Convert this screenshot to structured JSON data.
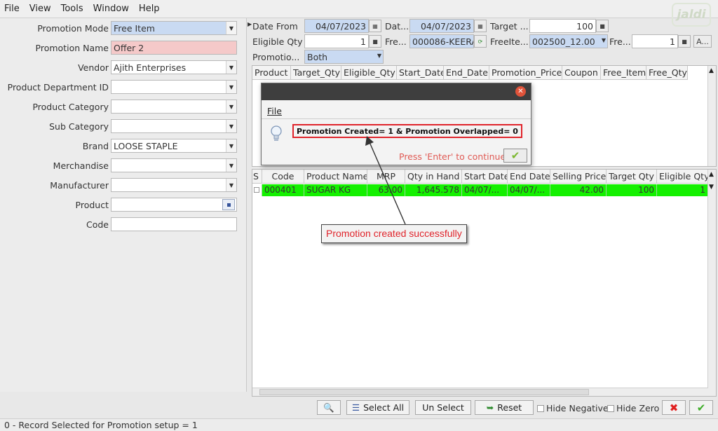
{
  "menubar": {
    "items": [
      "File",
      "View",
      "Tools",
      "Window",
      "Help"
    ]
  },
  "logo_text": "jaldi",
  "left_form": {
    "fields": [
      {
        "label": "Promotion Mode",
        "value": "Free Item",
        "style": "blue",
        "kind": "dropdown"
      },
      {
        "label": "Promotion Name",
        "value": "Offer 2",
        "style": "pink",
        "kind": "text"
      },
      {
        "label": "Vendor",
        "value": "Ajith Enterprises",
        "style": "white",
        "kind": "dropdown"
      },
      {
        "label": "Product Department ID",
        "value": "",
        "style": "white",
        "kind": "dropdown"
      },
      {
        "label": "Product Category",
        "value": "",
        "style": "white",
        "kind": "dropdown"
      },
      {
        "label": "Sub Category",
        "value": "",
        "style": "white",
        "kind": "dropdown"
      },
      {
        "label": "Brand",
        "value": "LOOSE STAPLE",
        "style": "white",
        "kind": "dropdown"
      },
      {
        "label": "Merchandise",
        "value": "",
        "style": "white",
        "kind": "dropdown"
      },
      {
        "label": "Manufacturer",
        "value": "",
        "style": "white",
        "kind": "dropdown"
      },
      {
        "label": "Product",
        "value": "",
        "style": "white",
        "kind": "picker"
      },
      {
        "label": "Code",
        "value": "",
        "style": "white",
        "kind": "text"
      }
    ]
  },
  "top_filters": {
    "date_from_label": "Date From",
    "date_from_value": "04/07/2023",
    "date_to_label": "Dat...",
    "date_to_value": "04/07/2023",
    "target_label": "Target ...",
    "target_value": "100",
    "eligible_label": "Eligible Qty",
    "eligible_value": "1",
    "free_label": "Fre...",
    "free_value": "000086-KEERA",
    "free_item_label": "FreeIte...",
    "free_item_value": "002500_12.00",
    "free_qty_label": "Fre...",
    "free_qty_value": "1",
    "a_button_label": "A...",
    "promo_label": "Promotio...",
    "promo_value": "Both"
  },
  "grid1": {
    "columns": [
      "Product",
      "Target_Qty",
      "Eligible_Qty",
      "Start_Date",
      "End_Date",
      "Promotion_Price",
      "Coupon",
      "Free_Item",
      "Free_Qty"
    ]
  },
  "grid2": {
    "columns": [
      "S",
      "Code",
      "Product Name",
      "MRP",
      "Qty in Hand",
      "Start Date",
      "End Date",
      "Selling Price",
      "Target Qty",
      "Eligible Qty"
    ],
    "row": [
      "",
      "000401",
      "SUGAR KG",
      "63.00",
      "1,645.578",
      "04/07/...",
      "04/07/...",
      "42.00",
      "100",
      "1"
    ]
  },
  "dialog": {
    "menu": "File",
    "message": "Promotion Created= 1 & Promotion Overlapped= 0",
    "press_text": "Press 'Enter' to continue"
  },
  "callout": "Promotion created successfully",
  "bottom": {
    "select_all": "Select All",
    "un_select": "Un Select",
    "reset": "Reset",
    "hide_negative": "Hide Negative",
    "hide_zero": "Hide Zero"
  },
  "status": "0 - Record Selected for Promotion setup = 1",
  "colors": {
    "highlight_row": "#14f000",
    "callout_text": "#e0242b",
    "message_border": "#e0242b"
  }
}
